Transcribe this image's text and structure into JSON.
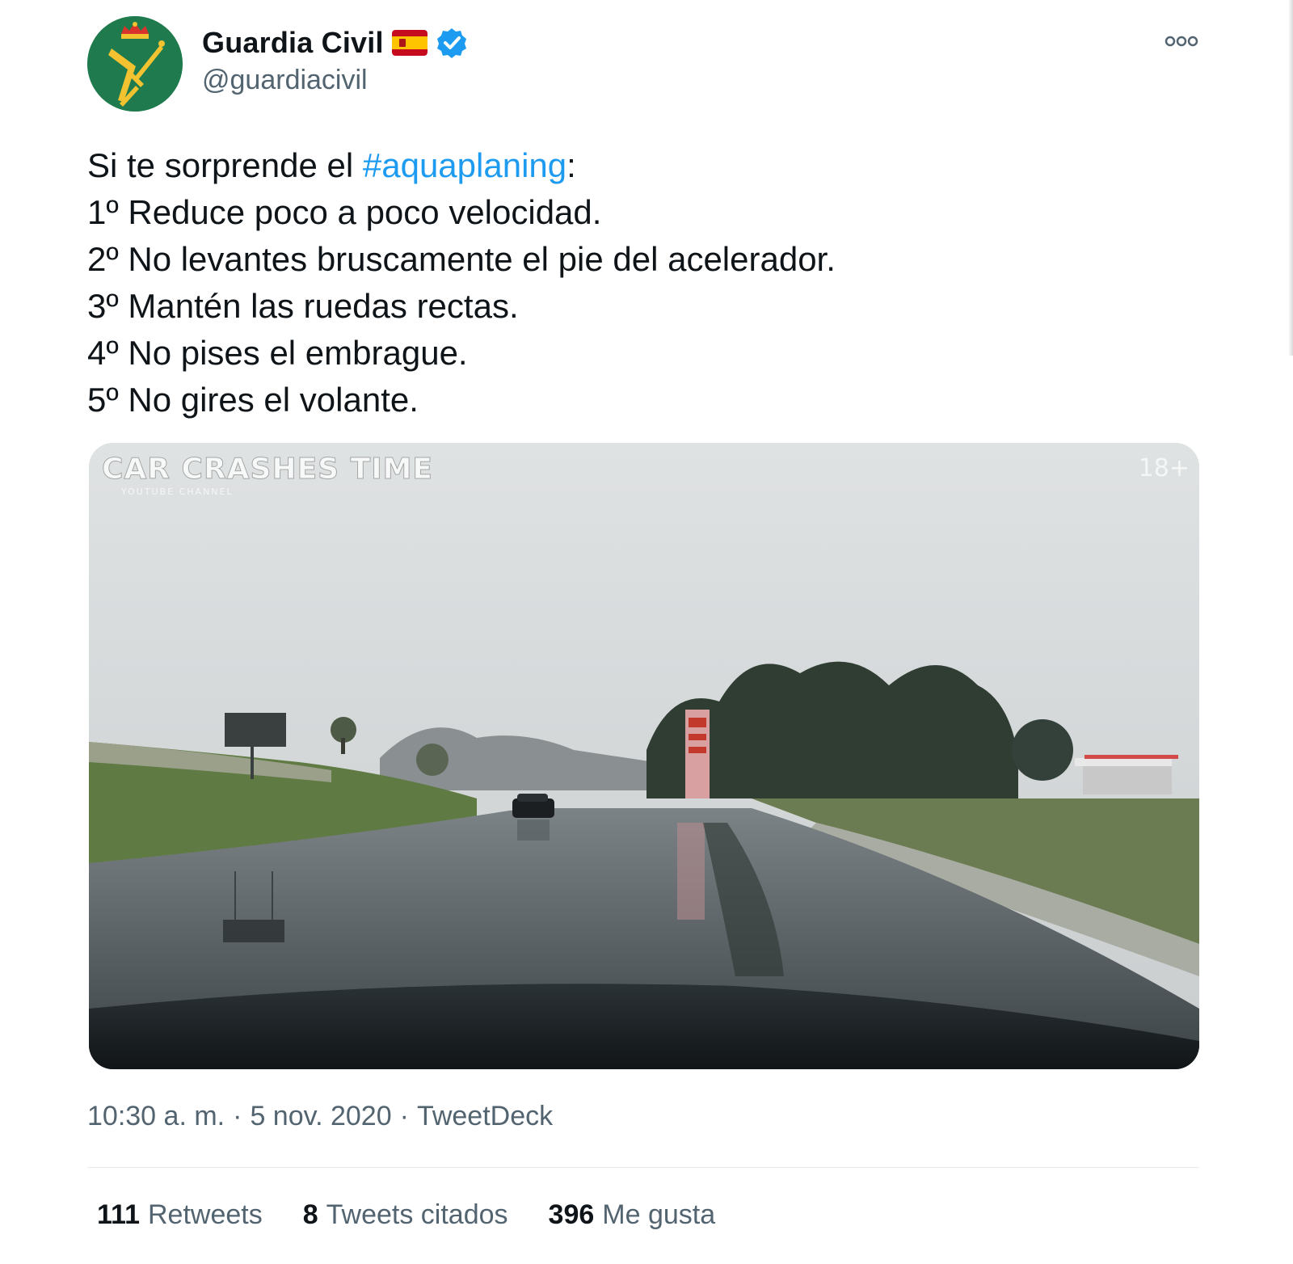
{
  "author": {
    "display_name": "Guardia Civil",
    "handle": "@guardiacivil",
    "flag_icon": "spain-flag-emoji",
    "verified_icon": "verified-badge-icon"
  },
  "tweet": {
    "line1_prefix": "Si te sorprende el ",
    "hashtag": "#aquaplaning",
    "line1_suffix": ":",
    "steps": [
      "1º Reduce poco a poco velocidad.",
      "2º No levantes bruscamente el pie del acelerador.",
      "3º Mantén las ruedas rectas.",
      "4º No pises el embrague.",
      "5º No gires el volante."
    ]
  },
  "media": {
    "watermark": "CAR CRASHES TIME",
    "watermark_sub": "YOUTUBE CHANNEL",
    "age_badge": "18+"
  },
  "meta": {
    "time": "10:30 a. m.",
    "separator": "·",
    "date": "5 nov. 2020",
    "source": "TweetDeck"
  },
  "stats": {
    "retweets_count": "111",
    "retweets_label": "Retweets",
    "quotes_count": "8",
    "quotes_label": "Tweets citados",
    "likes_count": "396",
    "likes_label": "Me gusta"
  },
  "colors": {
    "accent": "#1d9bf0",
    "avatar_bg": "#1f7a4d",
    "emblem": "#f2c230",
    "secondary_text": "#536471"
  }
}
